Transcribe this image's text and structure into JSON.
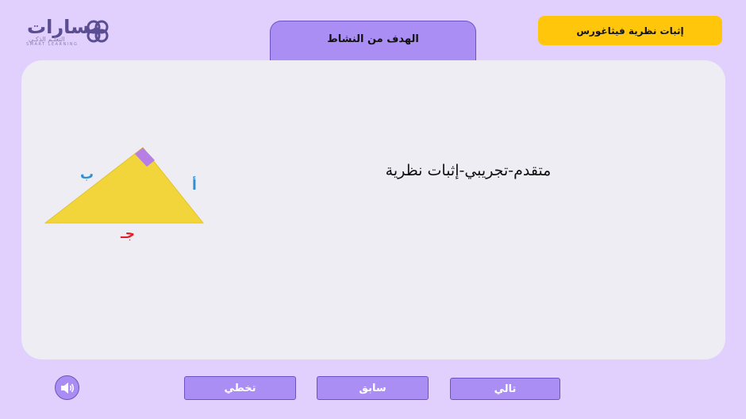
{
  "logo": {
    "brand_ar": "مسارات",
    "tagline_ar": "التعلـم الذكـي",
    "tagline_en": "SMART LEARNING"
  },
  "header": {
    "tab_label": "الهدف من النشاط",
    "activity_title": "إثبات نظرية فيثاغورس"
  },
  "card": {
    "text": "متقدم-تجريبي-إثبات نظرية",
    "triangle": {
      "label_a": "أ",
      "label_b": "ب",
      "label_c": "جـ",
      "fill_color": "#f1d53b",
      "right_angle_color": "#b77ee3"
    }
  },
  "footer": {
    "next_label": "تالي",
    "prev_label": "سابق",
    "skip_label": "تخطي",
    "sound_icon": "speaker-icon"
  },
  "colors": {
    "background": "#e1cffd",
    "accent": "#ab8ef3",
    "title_pill": "#ffc60b",
    "card": "#eeedf3"
  }
}
